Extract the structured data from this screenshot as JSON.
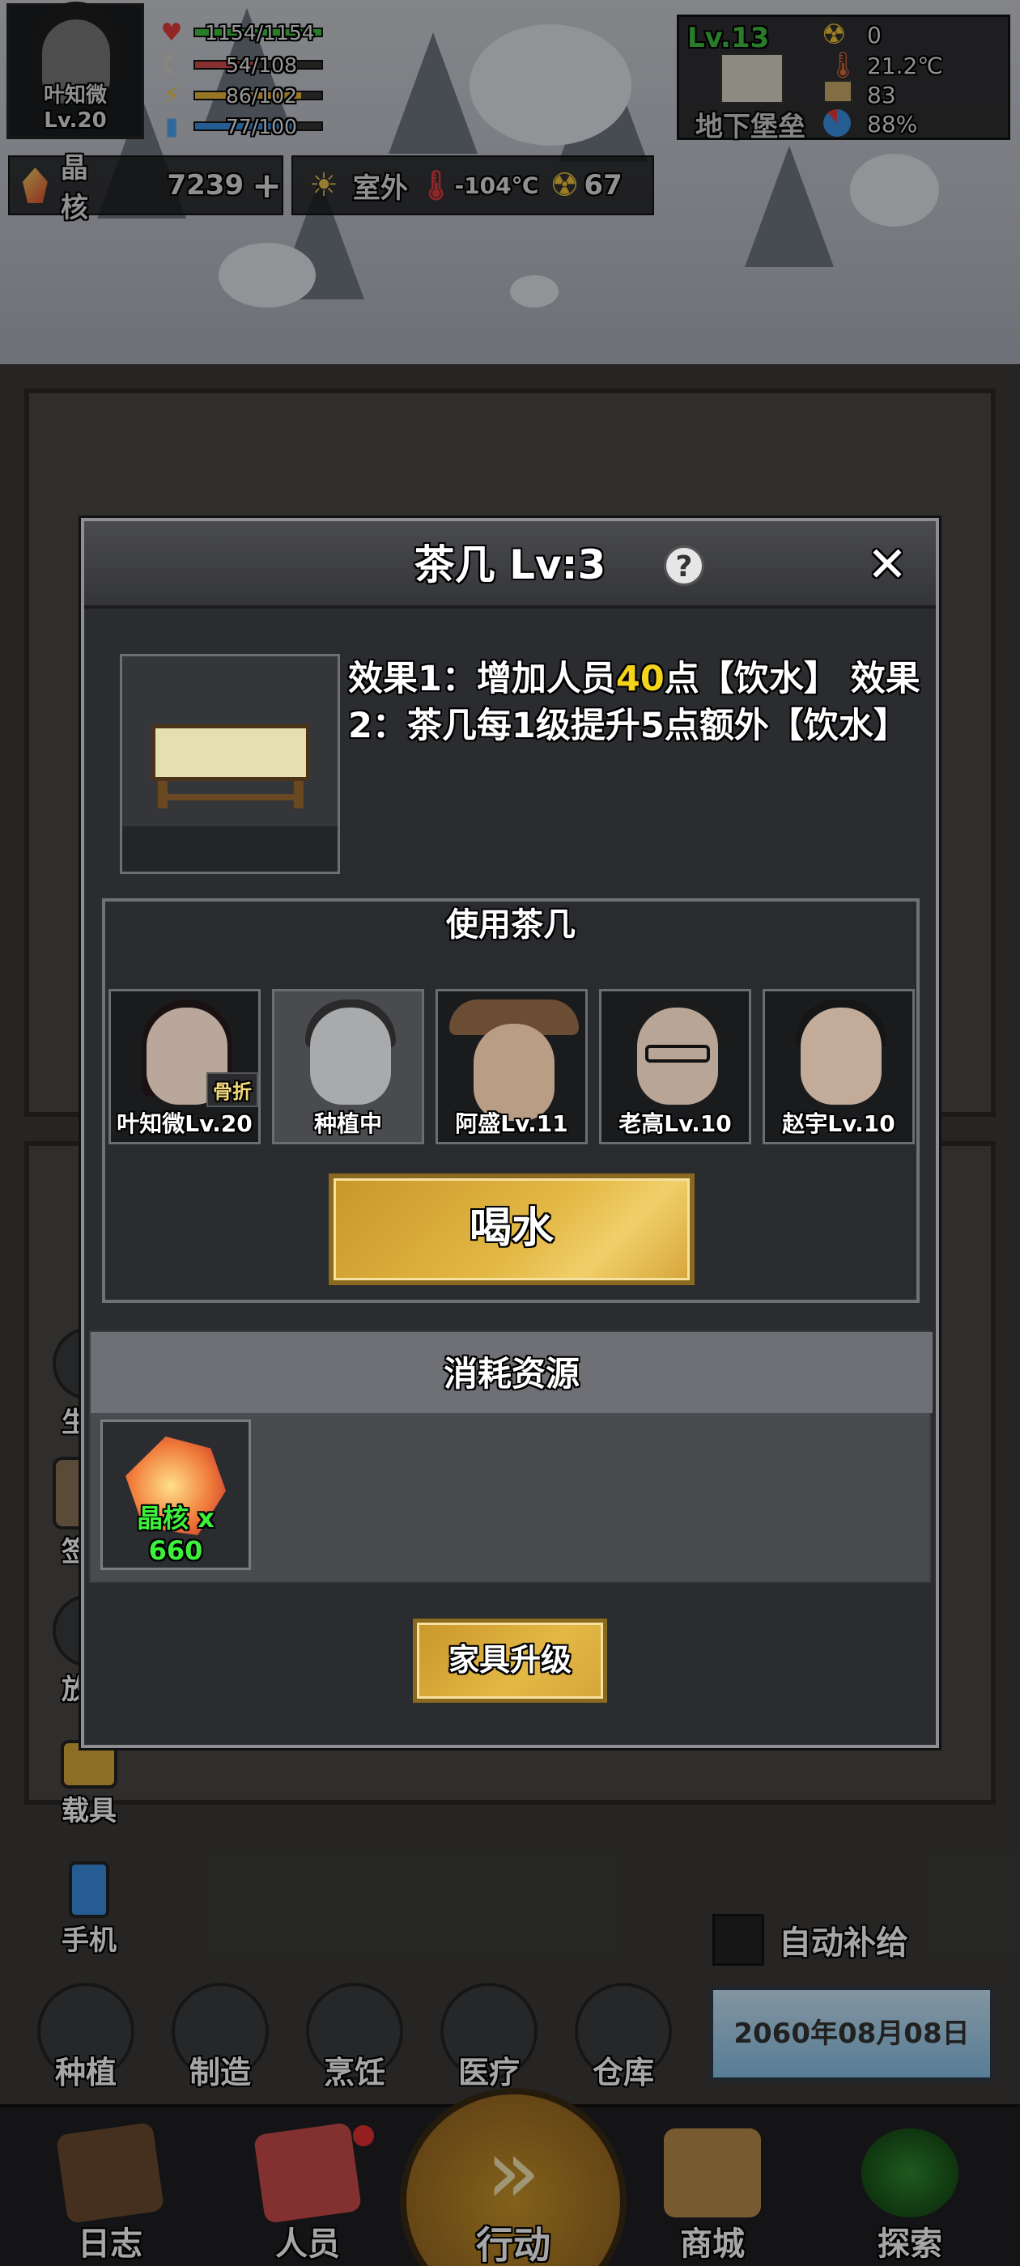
{
  "player": {
    "name_level": "叶知微 Lv.20",
    "stats": [
      {
        "icon": "heart-icon",
        "text": "1154/1154",
        "fill": 1.0,
        "color": "#3fbf3f"
      },
      {
        "icon": "food-icon",
        "text": "54/108",
        "fill": 0.5,
        "color": "#d24a4a"
      },
      {
        "icon": "energy-icon",
        "text": "86/102",
        "fill": 0.84,
        "color": "#e8b53a"
      },
      {
        "icon": "water-icon",
        "text": "77/100",
        "fill": 0.77,
        "color": "#3a8fe0"
      }
    ]
  },
  "hud": {
    "crystal_label": "晶核",
    "crystal_value": "7239",
    "plus": "+",
    "outdoor_label": "室外",
    "outdoor_temp": "-104℃",
    "radiation": "67"
  },
  "base": {
    "level": "Lv.13",
    "name": "地下堡垒",
    "radiation": "0",
    "temperature": "21.2℃",
    "supplies": "83",
    "ratio": "88%"
  },
  "dialog": {
    "title": "茶几 Lv:3",
    "help": "?",
    "close": "✕",
    "effect_a": "效果1：增加人员",
    "effect_hl": "40",
    "effect_b": "点【饮水】 效果2：茶几每1级提升5点额外【饮水】",
    "use_title": "使用茶几",
    "people": [
      {
        "name": "叶知微Lv.20",
        "tag": "骨折"
      },
      {
        "name": "种植中",
        "tag": ""
      },
      {
        "name": "阿盛Lv.11",
        "tag": ""
      },
      {
        "name": "老高Lv.10",
        "tag": ""
      },
      {
        "name": "赵宇Lv.10",
        "tag": ""
      }
    ],
    "drink_button": "喝水",
    "cost_title": "消耗资源",
    "resource_label": "晶核 x 660",
    "upgrade_button": "家具升级"
  },
  "side_menu": [
    {
      "label": "生存",
      "icon": "survival-icon"
    },
    {
      "label": "签到",
      "icon": "checkin-icon"
    },
    {
      "label": "放置",
      "icon": "place-icon"
    },
    {
      "label": "载具",
      "icon": "vehicle-icon"
    },
    {
      "label": "手机",
      "icon": "phone-icon"
    }
  ],
  "actions": [
    {
      "label": "种植",
      "icon": "sprout-icon"
    },
    {
      "label": "制造",
      "icon": "tools-icon"
    },
    {
      "label": "烹饪",
      "icon": "pot-icon"
    },
    {
      "label": "医疗",
      "icon": "medkit-icon"
    },
    {
      "label": "仓库",
      "icon": "crate-icon"
    }
  ],
  "auto_supply": "自动补给",
  "date": "2060年08月08日",
  "nav": [
    {
      "label": "日志",
      "icon": "book-icon"
    },
    {
      "label": "人员",
      "icon": "id-card-icon"
    },
    {
      "label": "行动",
      "icon": "fast-forward-icon"
    },
    {
      "label": "商城",
      "icon": "basket-icon"
    },
    {
      "label": "探索",
      "icon": "radar-icon"
    }
  ],
  "colors": {
    "accent_gold": "#e3b845",
    "highlight_yellow": "#f3d31b",
    "resource_green": "#3cf03c",
    "level_green": "#3fbf3f"
  }
}
